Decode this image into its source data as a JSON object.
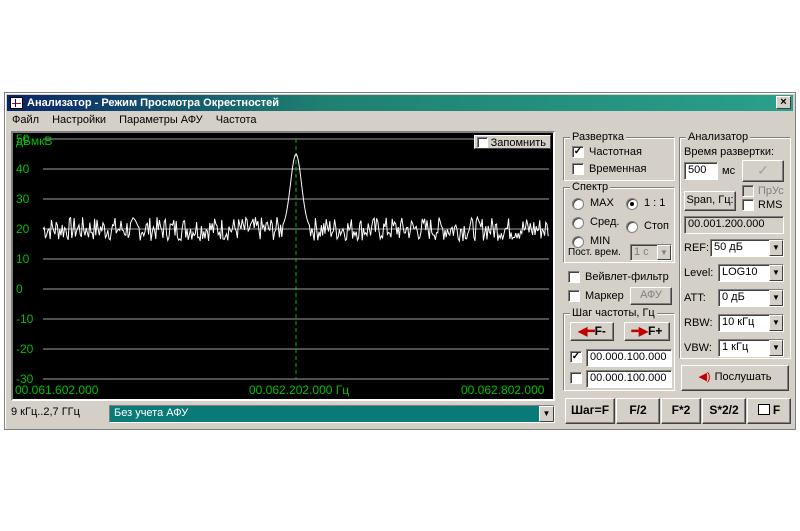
{
  "window": {
    "title": "Анализатор - Режим Просмотра Окрестностей",
    "close": "×"
  },
  "menu": [
    "Файл",
    "Настройки",
    "Параметры АФУ",
    "Частота"
  ],
  "plot": {
    "unit": "дБмкВ",
    "remember_label": "Запомнить",
    "y_ticks": [
      "50",
      "40",
      "30",
      "20",
      "10",
      "0",
      "-10",
      "-20",
      "-30"
    ],
    "x_left": "00.061.602.000",
    "x_center": "00.062.202.000 Гц",
    "x_right": "00.062.802.000"
  },
  "chart_data": {
    "type": "line",
    "ylim": [
      -30,
      50
    ],
    "yticks": [
      50,
      40,
      30,
      20,
      10,
      0,
      -10,
      -20,
      -30
    ],
    "x_range_hz": [
      61602000,
      62802000
    ],
    "center_marker_hz": 62202000,
    "noise_floor_db": 20,
    "peak": {
      "x_hz": 62202000,
      "value_db": 45
    },
    "series": [
      {
        "noise_amplitude_db": 4
      }
    ]
  },
  "sweep": {
    "title": "Развертка",
    "freq": "Частотная",
    "time": "Временная",
    "freq_checked": true,
    "time_checked": false
  },
  "spectrum": {
    "title": "Спектр",
    "max": "MAX",
    "avg": "Сред.",
    "min": "MIN",
    "ratio": "1 : 1",
    "stop": "Стоп",
    "const_label": "Пост. врем.",
    "const_value": "1 с"
  },
  "wavelet": "Вейвлет-фильтр",
  "marker": "Маркер",
  "afu_btn": "АФУ",
  "step": {
    "title": "Шаг частоты, Гц",
    "minus": "F-",
    "plus": "F+",
    "value1": "00.000.100.000",
    "value2": "00.000.100.000",
    "check1": true,
    "check2": false
  },
  "analyzer": {
    "title": "Анализатор",
    "sweep_time_label": "Время развертки:",
    "sweep_time": "500",
    "sweep_unit": "мс",
    "prus": "ПрУс",
    "rms": "RMS",
    "span_btn": "Span, Гц:",
    "span_value": "00.001.200.000",
    "ref_label": "REF:",
    "ref": "50 дБ",
    "level_label": "Level:",
    "level": "LOG10",
    "att_label": "ATT:",
    "att": "0 дБ",
    "rbw_label": "RBW:",
    "rbw": "10 кГц",
    "vbw_label": "VBW:",
    "vbw": "1 кГц",
    "listen": "Послушать"
  },
  "status": {
    "range": "9 кГц..2,7 ГГц",
    "afu_select": "Без учета АФУ"
  },
  "bottom_buttons": [
    "Шаг=F",
    "F/2",
    "F*2",
    "S*2/2",
    "F"
  ],
  "colors": {
    "trace": "#ffffff",
    "grid": "#a0a0a0",
    "label": "#00c000",
    "marker": "#00c000",
    "titlebar": "#1f8070"
  }
}
